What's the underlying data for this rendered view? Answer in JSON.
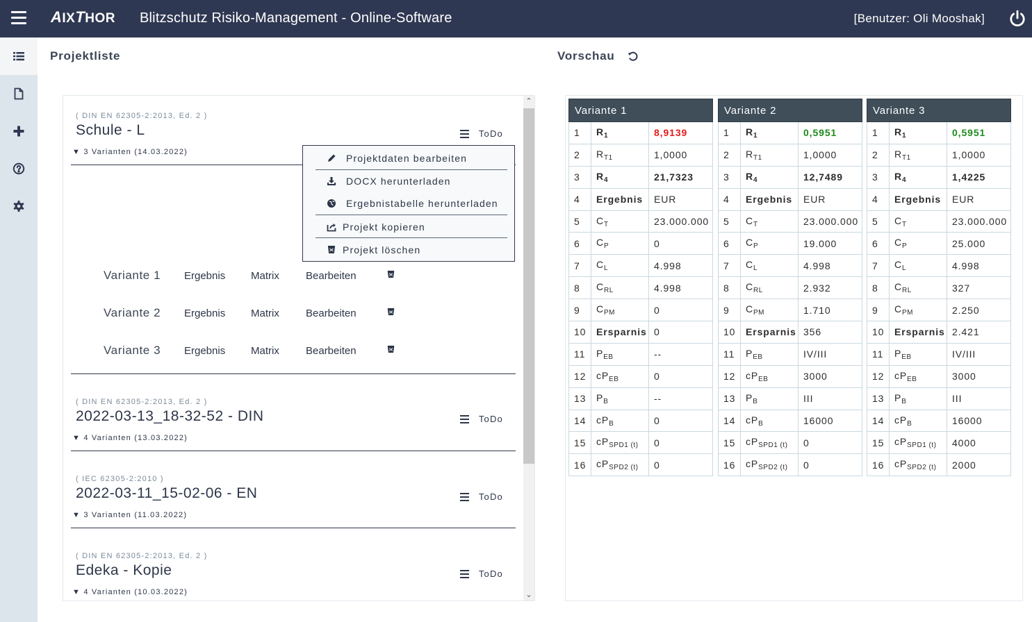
{
  "header": {
    "logo": "AIXTHOR",
    "logo_parts": [
      "A",
      "IX",
      "T",
      "HOR"
    ],
    "title": "Blitzschutz Risiko-Management - Online-Software",
    "user": "[Benutzer: Oli Mooshak]",
    "icons": {
      "menu": "hamburger-icon",
      "logout": "power-icon"
    }
  },
  "sidebar": {
    "items": [
      {
        "name": "project-list",
        "icon": "list-icon",
        "active": true
      },
      {
        "name": "new-document",
        "icon": "file-icon",
        "active": false
      },
      {
        "name": "add",
        "icon": "plus-icon",
        "active": false
      },
      {
        "name": "help",
        "icon": "question-circle-icon",
        "active": false
      },
      {
        "name": "settings",
        "icon": "gear-icon",
        "active": false
      }
    ]
  },
  "project_list": {
    "title": "Projektliste",
    "projects": [
      {
        "norm": "( DIN EN 62305-2:2013, Ed. 2 )",
        "name": "Schule - L",
        "variants_summary": "▼ 3 Varianten (14.03.2022)",
        "menu_label": "ToDo",
        "expanded": true,
        "variants": [
          {
            "name": "Variante 1",
            "result": "Ergebnis",
            "matrix": "Matrix",
            "edit": "Bearbeiten"
          },
          {
            "name": "Variante 2",
            "result": "Ergebnis",
            "matrix": "Matrix",
            "edit": "Bearbeiten"
          },
          {
            "name": "Variante 3",
            "result": "Ergebnis",
            "matrix": "Matrix",
            "edit": "Bearbeiten"
          }
        ]
      },
      {
        "norm": "( DIN EN 62305-2:2013, Ed. 2 )",
        "name": "2022-03-13_18-32-52 - DIN",
        "variants_summary": "▼ 4 Varianten (13.03.2022)",
        "menu_label": "ToDo"
      },
      {
        "norm": "( IEC 62305-2:2010 )",
        "name": "2022-03-11_15-02-06 - EN",
        "variants_summary": "▼ 3 Varianten (11.03.2022)",
        "menu_label": "ToDo"
      },
      {
        "norm": "( DIN EN 62305-2:2013, Ed. 2 )",
        "name": "Edeka - Kopie",
        "variants_summary": "▼ 4 Varianten (10.03.2022)",
        "menu_label": "ToDo"
      }
    ],
    "dropdown": {
      "items": [
        {
          "label": "Projektdaten bearbeiten",
          "icon": "pencil-icon"
        },
        {
          "label": "DOCX herunterladen",
          "icon": "download-icon"
        },
        {
          "label": "Ergebnistabelle herunterladen",
          "icon": "globe-icon"
        },
        {
          "label": "Projekt kopieren",
          "icon": "share-icon"
        },
        {
          "label": "Projekt löschen",
          "icon": "trash-icon"
        }
      ]
    }
  },
  "preview": {
    "title": "Vorschau",
    "refresh_icon": "refresh-icon",
    "colors": {
      "bad": "#e41c1c",
      "good": "#1d8a1d",
      "header": "#3f4e59"
    },
    "row_labels": [
      {
        "base": "R",
        "sub": "1",
        "bold": true
      },
      {
        "base": "R",
        "sub": "T1",
        "bold": false
      },
      {
        "base": "R",
        "sub": "4",
        "bold": true
      },
      {
        "base": "Ergebnis",
        "sub": "",
        "bold": true
      },
      {
        "base": "C",
        "sub": "T",
        "bold": false
      },
      {
        "base": "C",
        "sub": "P",
        "bold": false
      },
      {
        "base": "C",
        "sub": "L",
        "bold": false
      },
      {
        "base": "C",
        "sub": "RL",
        "bold": false
      },
      {
        "base": "C",
        "sub": "PM",
        "bold": false
      },
      {
        "base": "Ersparnis",
        "sub": "",
        "bold": true
      },
      {
        "base": "P",
        "sub": "EB",
        "bold": false
      },
      {
        "base": "cP",
        "sub": "EB",
        "bold": false
      },
      {
        "base": "P",
        "sub": "B",
        "bold": false
      },
      {
        "base": "cP",
        "sub": "B",
        "bold": false
      },
      {
        "base": "cP",
        "sub": "SPD1 (t)",
        "bold": false
      },
      {
        "base": "cP",
        "sub": "SPD2 (t)",
        "bold": false
      }
    ],
    "variants": [
      {
        "title": "Variante 1",
        "values": [
          "8,9139",
          "1,0000",
          "21,7323",
          "EUR",
          "23.000.000",
          "0",
          "4.998",
          "4.998",
          "0",
          "0",
          "--",
          "0",
          "--",
          "0",
          "0",
          "0"
        ],
        "r1_status": "red"
      },
      {
        "title": "Variante 2",
        "values": [
          "0,5951",
          "1,0000",
          "12,7489",
          "EUR",
          "23.000.000",
          "19.000",
          "4.998",
          "2.932",
          "1.710",
          "356",
          "IV/III",
          "3000",
          "III",
          "16000",
          "0",
          "0"
        ],
        "r1_status": "green"
      },
      {
        "title": "Variante 3",
        "values": [
          "0,5951",
          "1,0000",
          "1,4225",
          "EUR",
          "23.000.000",
          "25.000",
          "4.998",
          "327",
          "2.250",
          "2.421",
          "IV/III",
          "3000",
          "III",
          "16000",
          "4000",
          "2000"
        ],
        "r1_status": "green"
      }
    ]
  }
}
